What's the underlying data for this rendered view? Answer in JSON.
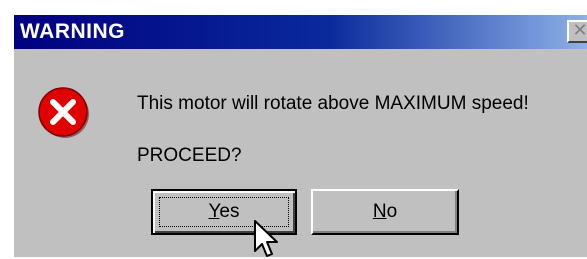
{
  "window": {
    "title": "WARNING",
    "close_glyph": "✕"
  },
  "content": {
    "icon": "error-icon",
    "message": "This motor will rotate above MAXIMUM speed!",
    "prompt": "PROCEED?"
  },
  "buttons": {
    "yes": {
      "mnemonic": "Y",
      "rest": "es",
      "label": "Yes"
    },
    "no": {
      "mnemonic": "N",
      "rest": "o",
      "label": "No"
    }
  },
  "colors": {
    "title_bar_start": "#000080",
    "title_bar_end": "#8eb1e8",
    "dialog_face": "#c0c0c0",
    "error_icon": "#e00000"
  }
}
